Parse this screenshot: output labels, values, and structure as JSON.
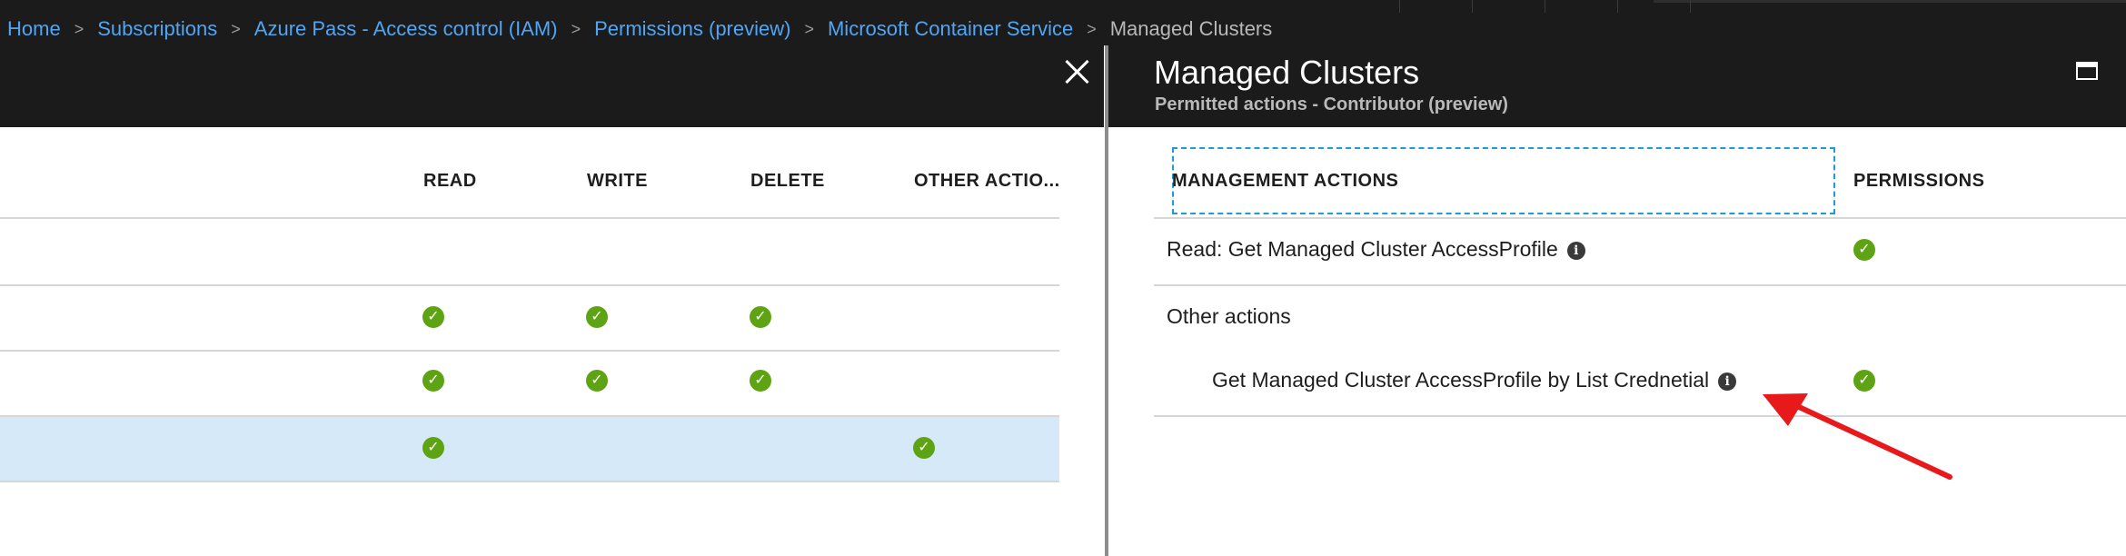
{
  "breadcrumb": {
    "items": [
      {
        "label": "Home"
      },
      {
        "label": "Subscriptions"
      },
      {
        "label": "Azure Pass - Access control (IAM)"
      },
      {
        "label": "Permissions (preview)"
      },
      {
        "label": "Microsoft Container Service"
      }
    ],
    "current": "Managed Clusters",
    "separator": ">"
  },
  "left_blade": {
    "columns": [
      "READ",
      "WRITE",
      "DELETE",
      "OTHER ACTIO..."
    ],
    "rows": [
      {
        "read": false,
        "write": false,
        "delete": false,
        "other": false,
        "selected": false
      },
      {
        "read": true,
        "write": true,
        "delete": true,
        "other": false,
        "selected": false
      },
      {
        "read": true,
        "write": true,
        "delete": true,
        "other": false,
        "selected": false
      },
      {
        "read": true,
        "write": false,
        "delete": false,
        "other": true,
        "selected": true
      }
    ],
    "close_icon": "close-icon"
  },
  "right_blade": {
    "title": "Managed Clusters",
    "subtitle": "Permitted actions - Contributor (preview)",
    "columns": {
      "actions": "MANAGEMENT ACTIONS",
      "permissions": "PERMISSIONS"
    },
    "rows": [
      {
        "label": "Read: Get Managed Cluster AccessProfile",
        "info": true,
        "permitted": true
      },
      {
        "label": "Other actions",
        "info": false,
        "permitted": false
      },
      {
        "label": "Get Managed Cluster AccessProfile by List Crednetial",
        "info": true,
        "permitted": true
      }
    ],
    "maximize_icon": "maximize-icon"
  },
  "colors": {
    "chrome": "#1b1b1b",
    "link": "#4ea6f5",
    "check": "#5ea313",
    "selected_row": "#d5e9f8",
    "focus": "#1b9bd7",
    "annotation_arrow": "#e8191b"
  }
}
